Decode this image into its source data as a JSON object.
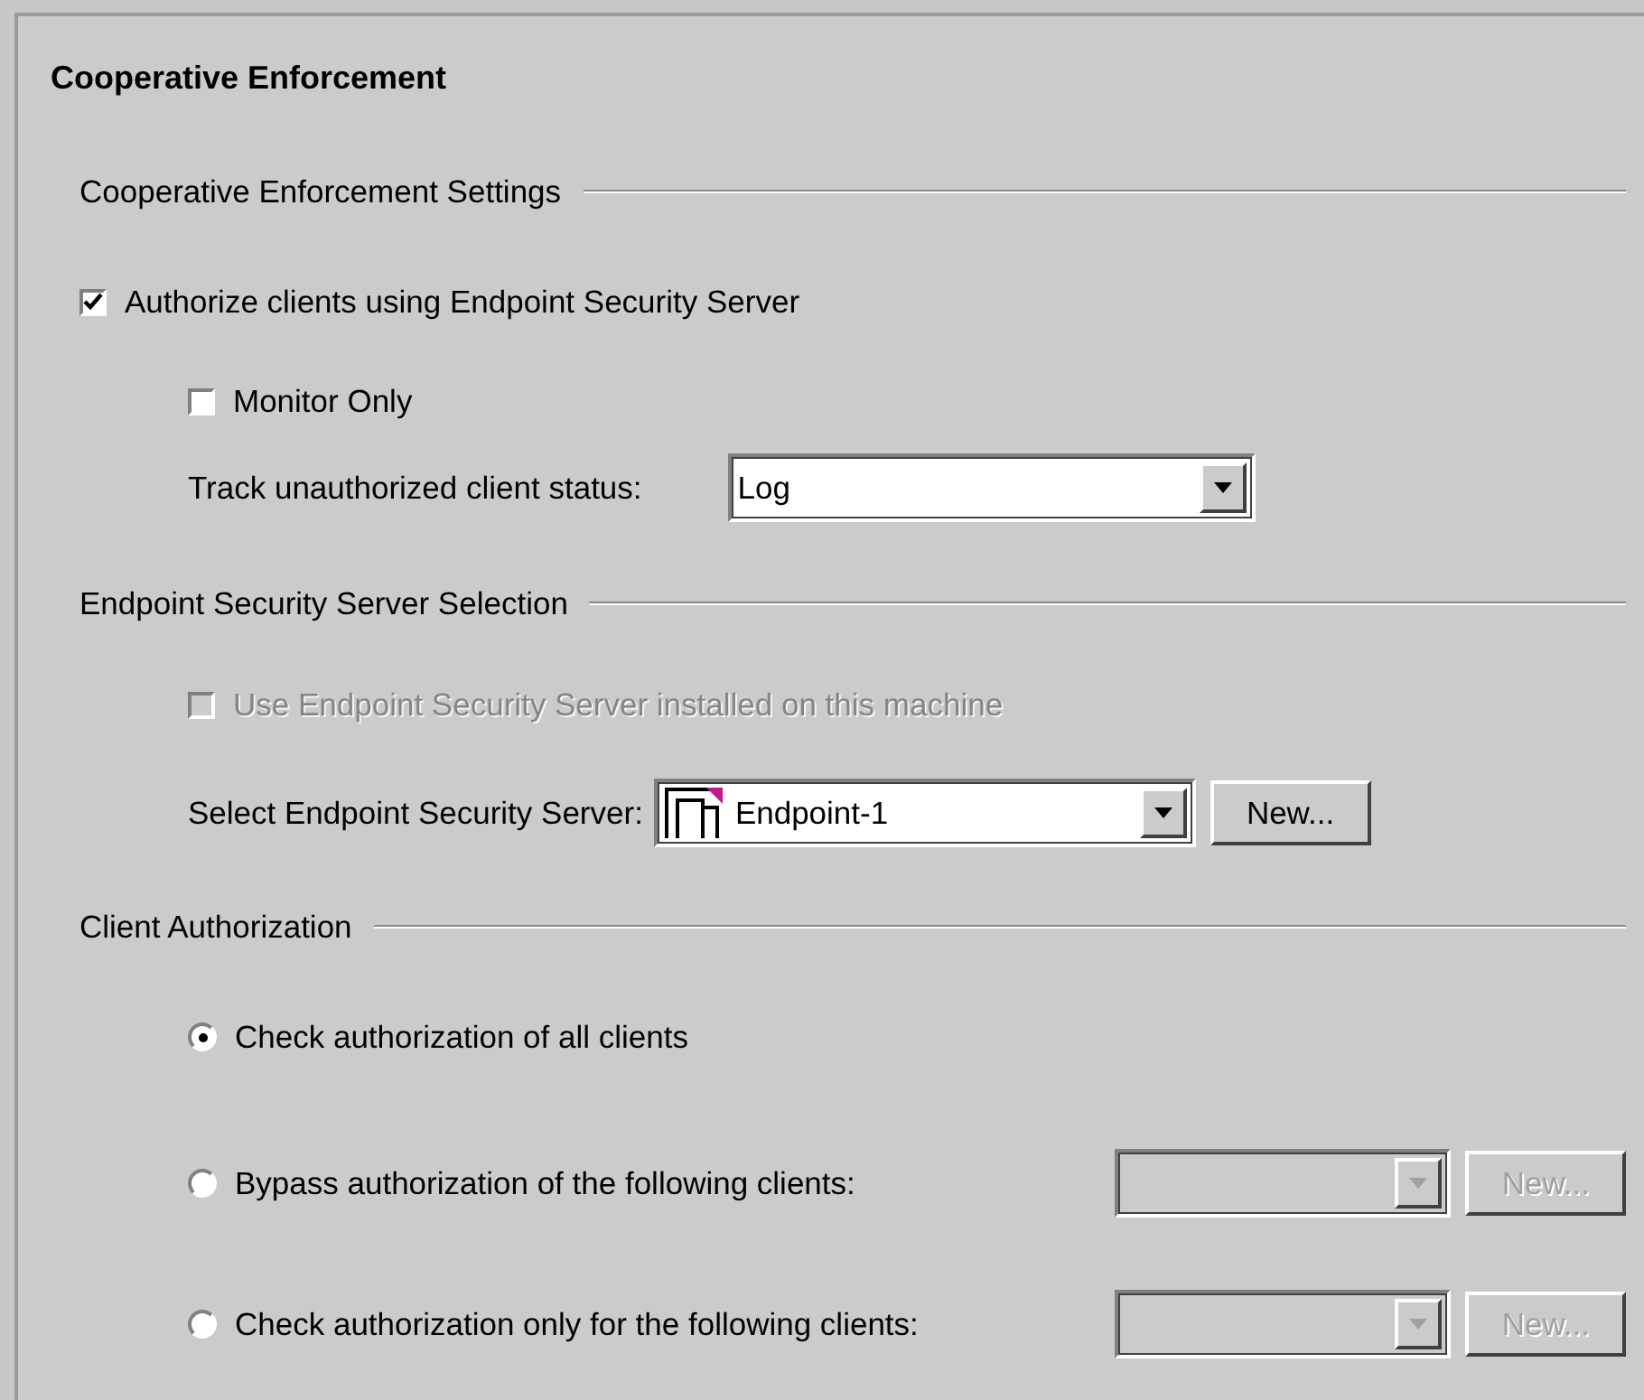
{
  "title": "Cooperative Enforcement",
  "settings": {
    "heading": "Cooperative Enforcement Settings",
    "authorize": {
      "label": "Authorize clients using Endpoint Security Server",
      "checked": true
    },
    "monitor_only": {
      "label": "Monitor Only",
      "checked": false
    },
    "track": {
      "label": "Track unauthorized client status:",
      "value": "Log"
    }
  },
  "server_selection": {
    "heading": "Endpoint Security Server Selection",
    "use_local": {
      "label": "Use Endpoint Security Server installed on this machine",
      "checked": false,
      "disabled": true
    },
    "select": {
      "label": "Select Endpoint Security Server:",
      "value": "Endpoint-1",
      "button": "New..."
    }
  },
  "client_authorization": {
    "heading": "Client Authorization",
    "options": [
      {
        "label": "Check authorization of all clients",
        "selected": true
      },
      {
        "label": "Bypass authorization of the following clients:",
        "selected": false,
        "controls": {
          "disabled": true,
          "button": "New..."
        }
      },
      {
        "label": "Check authorization only for the following clients:",
        "selected": false,
        "controls": {
          "disabled": true,
          "button": "New..."
        }
      }
    ]
  }
}
